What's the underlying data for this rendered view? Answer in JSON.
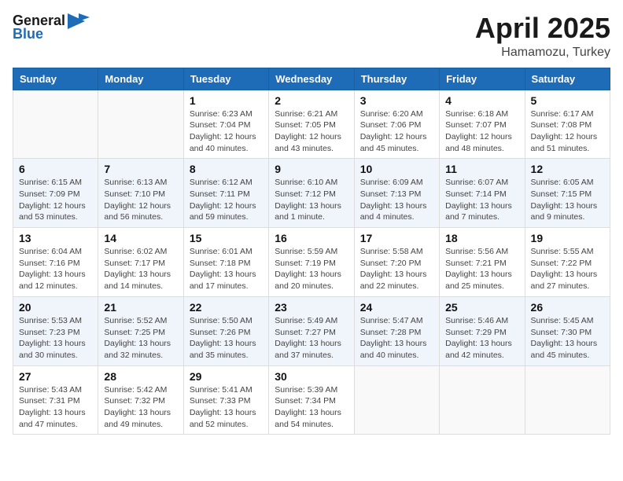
{
  "header": {
    "logo_general": "General",
    "logo_blue": "Blue",
    "title": "April 2025",
    "location": "Hamamozu, Turkey"
  },
  "days_of_week": [
    "Sunday",
    "Monday",
    "Tuesday",
    "Wednesday",
    "Thursday",
    "Friday",
    "Saturday"
  ],
  "weeks": [
    [
      {
        "day": "",
        "info": ""
      },
      {
        "day": "",
        "info": ""
      },
      {
        "day": "1",
        "info": "Sunrise: 6:23 AM\nSunset: 7:04 PM\nDaylight: 12 hours and 40 minutes."
      },
      {
        "day": "2",
        "info": "Sunrise: 6:21 AM\nSunset: 7:05 PM\nDaylight: 12 hours and 43 minutes."
      },
      {
        "day": "3",
        "info": "Sunrise: 6:20 AM\nSunset: 7:06 PM\nDaylight: 12 hours and 45 minutes."
      },
      {
        "day": "4",
        "info": "Sunrise: 6:18 AM\nSunset: 7:07 PM\nDaylight: 12 hours and 48 minutes."
      },
      {
        "day": "5",
        "info": "Sunrise: 6:17 AM\nSunset: 7:08 PM\nDaylight: 12 hours and 51 minutes."
      }
    ],
    [
      {
        "day": "6",
        "info": "Sunrise: 6:15 AM\nSunset: 7:09 PM\nDaylight: 12 hours and 53 minutes."
      },
      {
        "day": "7",
        "info": "Sunrise: 6:13 AM\nSunset: 7:10 PM\nDaylight: 12 hours and 56 minutes."
      },
      {
        "day": "8",
        "info": "Sunrise: 6:12 AM\nSunset: 7:11 PM\nDaylight: 12 hours and 59 minutes."
      },
      {
        "day": "9",
        "info": "Sunrise: 6:10 AM\nSunset: 7:12 PM\nDaylight: 13 hours and 1 minute."
      },
      {
        "day": "10",
        "info": "Sunrise: 6:09 AM\nSunset: 7:13 PM\nDaylight: 13 hours and 4 minutes."
      },
      {
        "day": "11",
        "info": "Sunrise: 6:07 AM\nSunset: 7:14 PM\nDaylight: 13 hours and 7 minutes."
      },
      {
        "day": "12",
        "info": "Sunrise: 6:05 AM\nSunset: 7:15 PM\nDaylight: 13 hours and 9 minutes."
      }
    ],
    [
      {
        "day": "13",
        "info": "Sunrise: 6:04 AM\nSunset: 7:16 PM\nDaylight: 13 hours and 12 minutes."
      },
      {
        "day": "14",
        "info": "Sunrise: 6:02 AM\nSunset: 7:17 PM\nDaylight: 13 hours and 14 minutes."
      },
      {
        "day": "15",
        "info": "Sunrise: 6:01 AM\nSunset: 7:18 PM\nDaylight: 13 hours and 17 minutes."
      },
      {
        "day": "16",
        "info": "Sunrise: 5:59 AM\nSunset: 7:19 PM\nDaylight: 13 hours and 20 minutes."
      },
      {
        "day": "17",
        "info": "Sunrise: 5:58 AM\nSunset: 7:20 PM\nDaylight: 13 hours and 22 minutes."
      },
      {
        "day": "18",
        "info": "Sunrise: 5:56 AM\nSunset: 7:21 PM\nDaylight: 13 hours and 25 minutes."
      },
      {
        "day": "19",
        "info": "Sunrise: 5:55 AM\nSunset: 7:22 PM\nDaylight: 13 hours and 27 minutes."
      }
    ],
    [
      {
        "day": "20",
        "info": "Sunrise: 5:53 AM\nSunset: 7:23 PM\nDaylight: 13 hours and 30 minutes."
      },
      {
        "day": "21",
        "info": "Sunrise: 5:52 AM\nSunset: 7:25 PM\nDaylight: 13 hours and 32 minutes."
      },
      {
        "day": "22",
        "info": "Sunrise: 5:50 AM\nSunset: 7:26 PM\nDaylight: 13 hours and 35 minutes."
      },
      {
        "day": "23",
        "info": "Sunrise: 5:49 AM\nSunset: 7:27 PM\nDaylight: 13 hours and 37 minutes."
      },
      {
        "day": "24",
        "info": "Sunrise: 5:47 AM\nSunset: 7:28 PM\nDaylight: 13 hours and 40 minutes."
      },
      {
        "day": "25",
        "info": "Sunrise: 5:46 AM\nSunset: 7:29 PM\nDaylight: 13 hours and 42 minutes."
      },
      {
        "day": "26",
        "info": "Sunrise: 5:45 AM\nSunset: 7:30 PM\nDaylight: 13 hours and 45 minutes."
      }
    ],
    [
      {
        "day": "27",
        "info": "Sunrise: 5:43 AM\nSunset: 7:31 PM\nDaylight: 13 hours and 47 minutes."
      },
      {
        "day": "28",
        "info": "Sunrise: 5:42 AM\nSunset: 7:32 PM\nDaylight: 13 hours and 49 minutes."
      },
      {
        "day": "29",
        "info": "Sunrise: 5:41 AM\nSunset: 7:33 PM\nDaylight: 13 hours and 52 minutes."
      },
      {
        "day": "30",
        "info": "Sunrise: 5:39 AM\nSunset: 7:34 PM\nDaylight: 13 hours and 54 minutes."
      },
      {
        "day": "",
        "info": ""
      },
      {
        "day": "",
        "info": ""
      },
      {
        "day": "",
        "info": ""
      }
    ]
  ]
}
